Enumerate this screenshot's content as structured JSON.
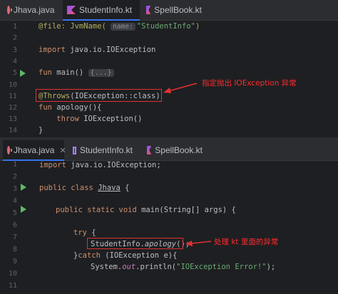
{
  "top": {
    "tabs": [
      {
        "label": "Jhava.java",
        "icon": "java-file-icon",
        "active": false
      },
      {
        "label": "StudentInfo.kt",
        "icon": "kotlin-file-icon",
        "active": true
      },
      {
        "label": "SpellBook.kt",
        "icon": "kotlin-file-icon",
        "active": false
      }
    ],
    "lines": [
      {
        "num": "1",
        "text": "@file: JvmName( name: \"StudentInfo\")"
      },
      {
        "num": "2",
        "text": ""
      },
      {
        "num": "3",
        "text": "import java.io.IOException"
      },
      {
        "num": "4",
        "text": ""
      },
      {
        "num": "5",
        "text": "fun main() {...}"
      },
      {
        "num": "10",
        "text": ""
      },
      {
        "num": "11",
        "text": "@Throws(IOException::class)"
      },
      {
        "num": "12",
        "text": "fun apology(){"
      },
      {
        "num": "13",
        "text": "    throw IOException()"
      },
      {
        "num": "14",
        "text": "}"
      }
    ],
    "code": {
      "file_ann": "@file",
      "colon": ": ",
      "jvmname": "JvmName(",
      "name_hint": "name:",
      "str_student": "\"StudentInfo\"",
      "close_paren": ")",
      "import_kw": "import",
      "import_path": " java.io.IOException",
      "fun_kw": "fun",
      "main_sig": " main() ",
      "fold": "{...}",
      "throws_ann": "@Throws",
      "throws_args": "(IOException::class)",
      "apology_sig": " apology(){",
      "throw_kw": "throw",
      "throw_rest": " IOException()",
      "close_brace": "}"
    },
    "annotation": "指定抛出 IOException 异常"
  },
  "bottom": {
    "tabs": [
      {
        "label": "Jhava.java",
        "icon": "java-file-icon",
        "active": true
      },
      {
        "label": "StudentInfo.kt",
        "icon": "kotlin-file-icon",
        "active": false
      },
      {
        "label": "SpellBook.kt",
        "icon": "kotlin-file-icon",
        "active": false
      }
    ],
    "lines": [
      {
        "num": "1",
        "text": "import java.io.IOException;"
      },
      {
        "num": "2",
        "text": ""
      },
      {
        "num": "3",
        "text": "public class Jhava {"
      },
      {
        "num": "4",
        "text": ""
      },
      {
        "num": "5",
        "text": "    public static void main(String[] args) {"
      },
      {
        "num": "6",
        "text": ""
      },
      {
        "num": "7",
        "text": "        try {"
      },
      {
        "num": "8",
        "text": "            StudentInfo.apology();"
      },
      {
        "num": "9",
        "text": "        }catch (IOException e){"
      },
      {
        "num": "10",
        "text": "            System.out.println(\"IOException Error!\");"
      },
      {
        "num": "11",
        "text": ""
      }
    ],
    "code": {
      "import_kw": "import",
      "import_path": " java.io.IOException;",
      "public_class": "public class ",
      "class_name": "Jhava",
      "open_brace": " {",
      "public_static_void": "public static void ",
      "main_sig": "main(String[] args) {",
      "try_kw": "try",
      "brace_open": " {",
      "call_class": "StudentInfo.",
      "call_method": "apology",
      "call_end": "();",
      "close_brace": "}",
      "catch_kw": "catch",
      "catch_rest": " (IOException e){",
      "sys": "System.",
      "out": "out",
      "println": ".println(",
      "err_str": "\"IOException Error!\"",
      "println_end": ");"
    },
    "annotation": "处理 kt 里面的异常"
  },
  "colors": {
    "background": "#1e1f22",
    "keyword": "#cf8e6d",
    "annotation": "#b3ae60",
    "string": "#6aab73",
    "highlight_box": "#e03131"
  }
}
